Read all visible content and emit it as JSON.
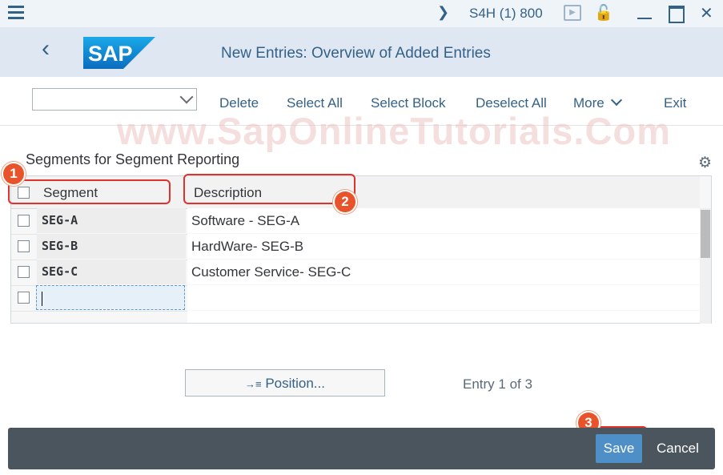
{
  "system": {
    "system_id": "S4H (1) 800"
  },
  "header": {
    "title": "New Entries: Overview of Added Entries",
    "logo_text": "SAP"
  },
  "toolbar": {
    "dropdown_value": "",
    "delete": "Delete",
    "select_all": "Select All",
    "select_block": "Select Block",
    "deselect_all": "Deselect All",
    "more": "More",
    "exit": "Exit"
  },
  "watermark": "www.SapOnlineTutorials.Com",
  "section": {
    "title": "Segments for Segment Reporting"
  },
  "table": {
    "columns": [
      "Segment",
      "Description"
    ],
    "rows": [
      {
        "segment": "SEG-A",
        "description": "Software - SEG-A"
      },
      {
        "segment": "SEG-B",
        "description": "HardWare- SEG-B"
      },
      {
        "segment": "SEG-C",
        "description": "Customer Service- SEG-C"
      }
    ]
  },
  "annotations": [
    "1",
    "2",
    "3"
  ],
  "footer": {
    "position_label": "Position...",
    "entry_text": "Entry 1 of 3",
    "save": "Save",
    "cancel": "Cancel"
  },
  "colors": {
    "accent": "#346187",
    "title_bar": "#dfe8f2",
    "footer_bar": "#4b555e",
    "save_button": "#4f8fc8",
    "annotation_red": "#e0312b",
    "badge_orange": "#e8532b"
  }
}
